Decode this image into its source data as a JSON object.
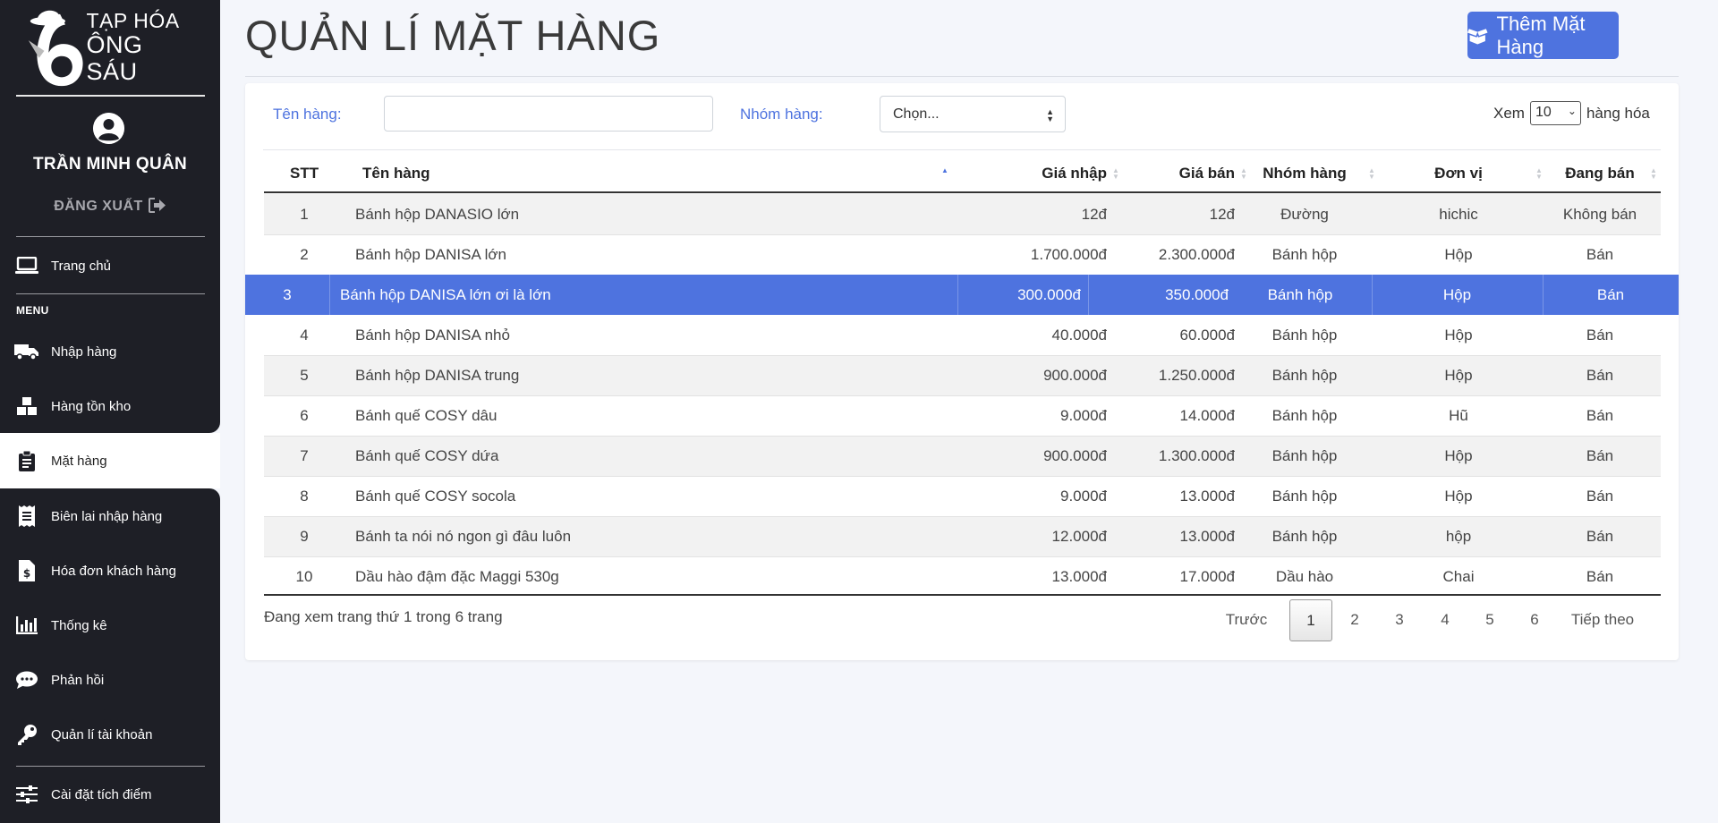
{
  "app": {
    "logo_line1": "TẠP HÓA",
    "logo_line2": "ÔNG SÁU"
  },
  "user": {
    "name": "TRẦN MINH QUÂN",
    "logout_label": "ĐĂNG XUẤT"
  },
  "sidebar": {
    "home": "Trang chủ",
    "menu_label": "MENU",
    "items": [
      {
        "label": "Nhập hàng",
        "icon": "truck-icon"
      },
      {
        "label": "Hàng tồn kho",
        "icon": "boxes-icon"
      },
      {
        "label": "Mặt hàng",
        "icon": "clipboard-icon",
        "active": true
      },
      {
        "label": "Biên lai nhập hàng",
        "icon": "receipt-icon"
      },
      {
        "label": "Hóa đơn khách hàng",
        "icon": "invoice-icon"
      },
      {
        "label": "Thống kê",
        "icon": "chart-icon"
      },
      {
        "label": "Phản hồi",
        "icon": "comment-icon"
      },
      {
        "label": "Quản lí tài khoản",
        "icon": "key-icon"
      }
    ],
    "settings": "Cài đặt tích điểm"
  },
  "header": {
    "title": "QUẢN LÍ MẶT HÀNG",
    "add_button": "Thêm Mặt Hàng"
  },
  "filters": {
    "name_label": "Tên hàng:",
    "name_value": "",
    "group_label": "Nhóm hàng:",
    "group_value": "Chọn...",
    "show_prefix": "Xem",
    "show_value": "10",
    "show_suffix": "hàng hóa"
  },
  "table": {
    "columns": [
      "STT",
      "Tên hàng",
      "Giá nhập",
      "Giá bán",
      "Nhóm hàng",
      "Đơn vị",
      "Đang bán"
    ],
    "rows": [
      [
        "1",
        "Bánh hộp DANASIO lớn",
        "12đ",
        "12đ",
        "Đường",
        "hichic",
        "Không bán"
      ],
      [
        "2",
        "Bánh hộp DANISA lớn",
        "1.700.000đ",
        "2.300.000đ",
        "Bánh hộp",
        "Hộp",
        "Bán"
      ],
      [
        "3",
        "Bánh hộp DANISA lớn ơi là lớn",
        "300.000đ",
        "350.000đ",
        "Bánh hộp",
        "Hộp",
        "Bán"
      ],
      [
        "4",
        "Bánh hộp DANISA nhỏ",
        "40.000đ",
        "60.000đ",
        "Bánh hộp",
        "Hộp",
        "Bán"
      ],
      [
        "5",
        "Bánh hộp DANISA trung",
        "900.000đ",
        "1.250.000đ",
        "Bánh hộp",
        "Hộp",
        "Bán"
      ],
      [
        "6",
        "Bánh quế COSY dâu",
        "9.000đ",
        "14.000đ",
        "Bánh hộp",
        "Hũ",
        "Bán"
      ],
      [
        "7",
        "Bánh quế COSY dứa",
        "900.000đ",
        "1.300.000đ",
        "Bánh hộp",
        "Hộp",
        "Bán"
      ],
      [
        "8",
        "Bánh quế COSY socola",
        "9.000đ",
        "13.000đ",
        "Bánh hộp",
        "Hộp",
        "Bán"
      ],
      [
        "9",
        "Bánh ta nói nó ngon gì đâu luôn",
        "12.000đ",
        "13.000đ",
        "Bánh hộp",
        "hộp",
        "Bán"
      ],
      [
        "10",
        "Dầu hào đậm đặc Maggi 530g",
        "13.000đ",
        "17.000đ",
        "Dầu hào",
        "Chai",
        "Bán"
      ]
    ],
    "selected_row": 2
  },
  "pagination": {
    "info": "Đang xem trang thứ 1 trong 6 trang",
    "prev": "Trước",
    "pages": [
      "1",
      "2",
      "3",
      "4",
      "5",
      "6"
    ],
    "current": "1",
    "next": "Tiếp theo"
  },
  "colors": {
    "accent": "#4e73df",
    "sidebar": "#1e1f26"
  }
}
